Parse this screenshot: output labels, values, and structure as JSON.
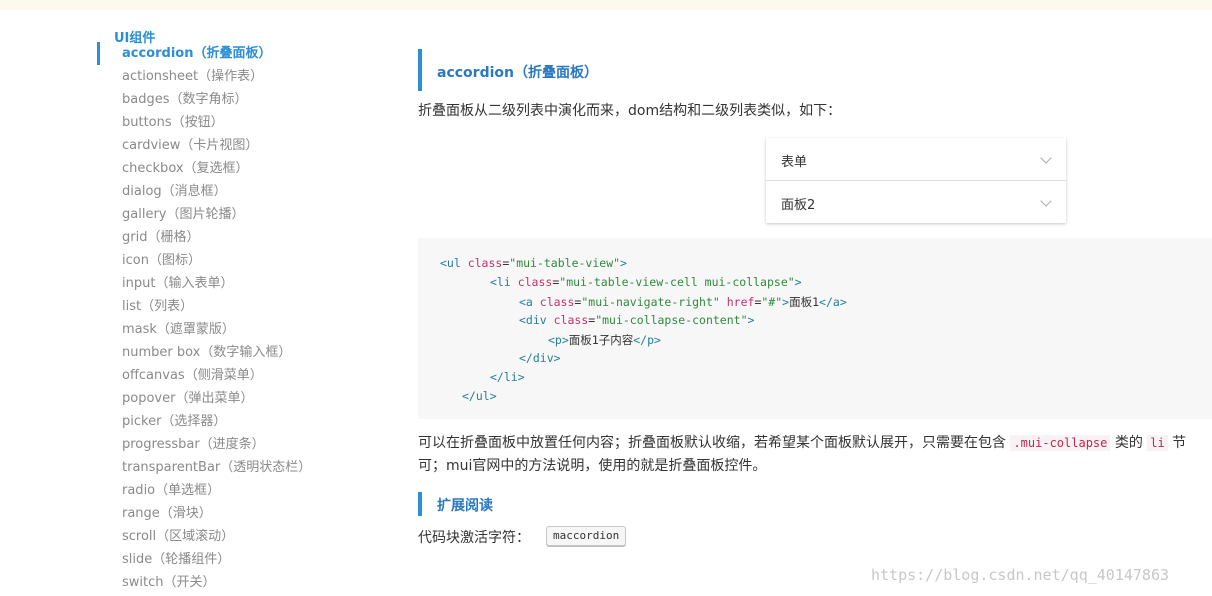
{
  "sidebar": {
    "title": "UI组件",
    "items": [
      {
        "label": "accordion（折叠面板）",
        "active": true
      },
      {
        "label": "actionsheet（操作表）"
      },
      {
        "label": "badges（数字角标）"
      },
      {
        "label": "buttons（按钮）"
      },
      {
        "label": "cardview（卡片视图）"
      },
      {
        "label": "checkbox（复选框）"
      },
      {
        "label": "dialog（消息框）"
      },
      {
        "label": "gallery（图片轮播）"
      },
      {
        "label": "grid（栅格）"
      },
      {
        "label": "icon（图标）"
      },
      {
        "label": "input（输入表单）"
      },
      {
        "label": "list（列表）"
      },
      {
        "label": "mask（遮罩蒙版）"
      },
      {
        "label": "number box（数字输入框）"
      },
      {
        "label": "offcanvas（侧滑菜单）"
      },
      {
        "label": "popover（弹出菜单）"
      },
      {
        "label": "picker（选择器）"
      },
      {
        "label": "progressbar（进度条）"
      },
      {
        "label": "transparentBar（透明状态栏）"
      },
      {
        "label": "radio（单选框）"
      },
      {
        "label": "range（滑块）"
      },
      {
        "label": "scroll（区域滚动）"
      },
      {
        "label": "slide（轮播组件）"
      },
      {
        "label": "switch（开关）"
      }
    ]
  },
  "main": {
    "heading": "accordion（折叠面板）",
    "intro": "折叠面板从二级列表中演化而来，dom结构和二级列表类似，如下：",
    "demo": {
      "panel1_label": "表单",
      "panel2_label": "面板2"
    },
    "code": {
      "line1_open": "<ul ",
      "line1_attr": "class",
      "line1_eq": "=",
      "line1_val": "\"mui-table-view\"",
      "line1_close": ">",
      "line2_open": "<li ",
      "line2_attr": "class",
      "line2_eq": "=",
      "line2_val": "\"mui-table-view-cell mui-collapse\"",
      "line2_close": ">",
      "line3_open": "<a ",
      "line3_attr1": "class",
      "line3_eq1": "=",
      "line3_val1": "\"mui-navigate-right\"",
      "line3_attr2": " href",
      "line3_eq2": "=",
      "line3_val2": "\"#\"",
      "line3_gt": ">",
      "line3_text": "面板1",
      "line3_end": "</a>",
      "line4_open": "<div ",
      "line4_attr": "class",
      "line4_eq": "=",
      "line4_val": "\"mui-collapse-content\"",
      "line4_close": ">",
      "line5_open": "<p>",
      "line5_text": "面板1子内容",
      "line5_end": "</p>",
      "line6": "</div>",
      "line7": "</li>",
      "line8": "</ul>"
    },
    "para": {
      "line1_a": "可以在折叠面板中放置任何内容；折叠面板默认收缩，若希望某个面板默认展开，只需要在包含 ",
      "line1_code1": ".mui-collapse",
      "line1_b": " 类的 ",
      "line1_code2": "li",
      "line1_c": " 节",
      "line2": "可；mui官网中的方法说明，使用的就是折叠面板控件。"
    },
    "subheading": "扩展阅读",
    "snippet_label": "代码块激活字符：",
    "snippet_key": "maccordion"
  },
  "watermark": "https://blog.csdn.net/qq_40147863",
  "colors": {
    "accent": "#2b8ed6",
    "topbar": "#fdf9ec",
    "code_bg": "#f7f7f7"
  }
}
